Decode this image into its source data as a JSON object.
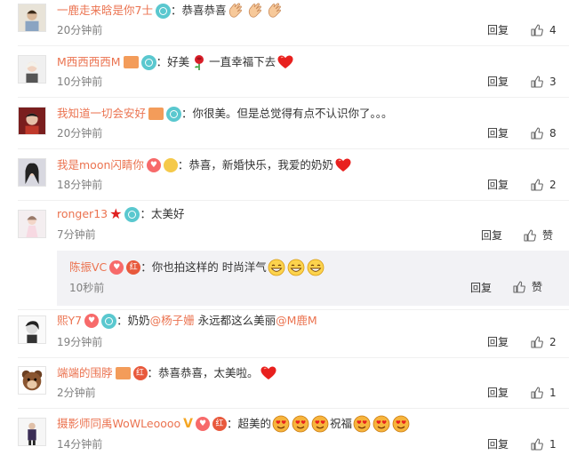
{
  "comments": [
    {
      "user": "一鹿走来晗是你7士",
      "badges": [
        "vip"
      ],
      "text": "：恭喜恭喜",
      "emojis": [
        "clap-emoji",
        "clap-emoji",
        "clap-emoji"
      ],
      "time": "20分钟前",
      "reply_label": "回复",
      "likes": "4"
    },
    {
      "user": "M西西西西M",
      "badges": [
        "gift",
        "vip"
      ],
      "text_before": "：好美",
      "text_after": "一直幸福下去",
      "time": "10分钟前",
      "reply_label": "回复",
      "likes": "3"
    },
    {
      "user": "我知道一切会安好",
      "badges": [
        "gift",
        "vip"
      ],
      "text": "：你很美。但是总觉得有点不认识你了。。。",
      "time": "20分钟前",
      "reply_label": "回复",
      "likes": "8"
    },
    {
      "user": "我是moon闪睛你",
      "badges": [
        "heart",
        "cat"
      ],
      "text": "：恭喜，新婚快乐，我爱的奶奶",
      "time": "18分钟前",
      "reply_label": "回复",
      "likes": "2"
    },
    {
      "user": "ronger13",
      "badges": [
        "star",
        "vip"
      ],
      "text": "：太美好",
      "time": "7分钟前",
      "reply_label": "回复",
      "likes": "赞",
      "sub_reply": {
        "user": "陈振VC",
        "badges": [
          "heart",
          "hong"
        ],
        "text": "：你也拍这样的 时尚洋气",
        "time": "10秒前",
        "reply_label": "回复",
        "likes": "赞"
      }
    },
    {
      "user": "熙Y7",
      "badges": [
        "heart",
        "vip"
      ],
      "text_before": "：奶奶",
      "mention1": "@杨子姗",
      "text_middle": " 永远都这么美丽",
      "mention2": "@M鹿M",
      "time": "19分钟前",
      "reply_label": "回复",
      "likes": "2"
    },
    {
      "user": "端端的围脖",
      "badges": [
        "gift",
        "hong"
      ],
      "text": "：恭喜恭喜，太美啦。",
      "time": "2分钟前",
      "reply_label": "回复",
      "likes": "1"
    },
    {
      "user": "摄影师同禹WoWLeoooo",
      "badges": [
        "v",
        "heart",
        "hong"
      ],
      "text_before": "：超美的",
      "text_middle": "祝福",
      "time": "14分钟前",
      "reply_label": "回复",
      "likes": "1"
    }
  ],
  "colors": {
    "username": "#eb7350",
    "mention": "#eb7350",
    "time": "#808080",
    "vip_badge": "#5ac8cf",
    "sub_reply_bg": "#f2f2f5"
  },
  "badge_text": {
    "hong": "红"
  }
}
